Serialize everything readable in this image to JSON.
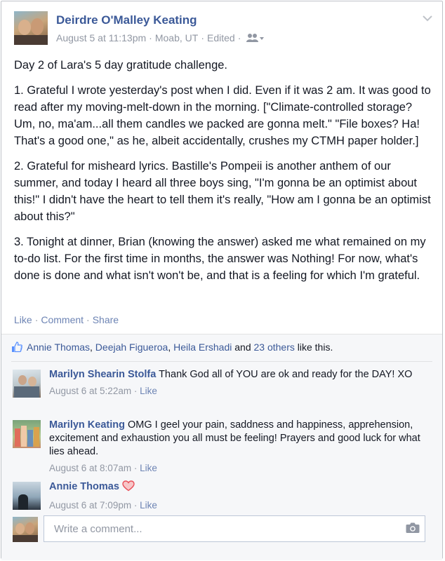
{
  "post": {
    "author": "Deirdre O'Malley Keating",
    "timestamp": "August 5 at 11:13pm",
    "location": "Moab, UT",
    "edited": "Edited",
    "meta_separator": "·",
    "audience_icon": "friends-icon",
    "paragraphs": [
      "Day 2 of Lara's 5 day gratitude challenge.",
      "1. Grateful I wrote yesterday's post when I did. Even if it was 2 am. It was good to read after my moving-melt-down in the morning. [\"Climate-controlled storage? Um, no, ma'am...all them candles we packed are gonna melt.\" \"File boxes? Ha! That's a good one,\" as he, albeit accidentally, crushes my CTMH paper holder.]",
      "2. Grateful for misheard lyrics. Bastille's Pompeii is another anthem of our summer, and today I heard all three boys sing, \"I'm gonna be an optimist about this!\" I didn't have the heart to tell them it's really, \"How am I gonna be an optimist about this?\"",
      "3. Tonight at dinner, Brian (knowing the answer) asked me what remained on my to-do list. For the first time in months, the answer was Nothing! For now, what's done is done and what isn't won't be, and that is a feeling for which I'm grateful."
    ]
  },
  "actions": {
    "like": "Like",
    "comment": "Comment",
    "share": "Share",
    "separator": "·"
  },
  "likes": {
    "names": [
      "Annie Thomas",
      "Deejah Figueroa",
      "Heila Ershadi"
    ],
    "comma": ",",
    "and_text": "and",
    "others": "23 others",
    "suffix": "like this."
  },
  "comments": [
    {
      "name": "Marilyn Shearin Stolfa",
      "text": "Thank God all of YOU are ok and ready for the DAY! XO",
      "time": "August 6 at 5:22am",
      "like": "Like"
    },
    {
      "name": "Marilyn Keating",
      "text": "OMG I geel your pain, saddness and happiness, apprehension, excitement and exhaustion you all must be feeling! Prayers and good luck for what lies ahead.",
      "time": "August 6 at 8:07am",
      "like": "Like"
    },
    {
      "name": "Annie Thomas",
      "text": "",
      "time": "August 6 at 7:09pm",
      "like": "Like",
      "icon": "heart-icon"
    }
  ],
  "composer": {
    "placeholder": "Write a comment...",
    "icon": "camera-icon"
  },
  "colors": {
    "link": "#3b5998",
    "muted": "#9197a3",
    "heart": "#e9505a"
  }
}
